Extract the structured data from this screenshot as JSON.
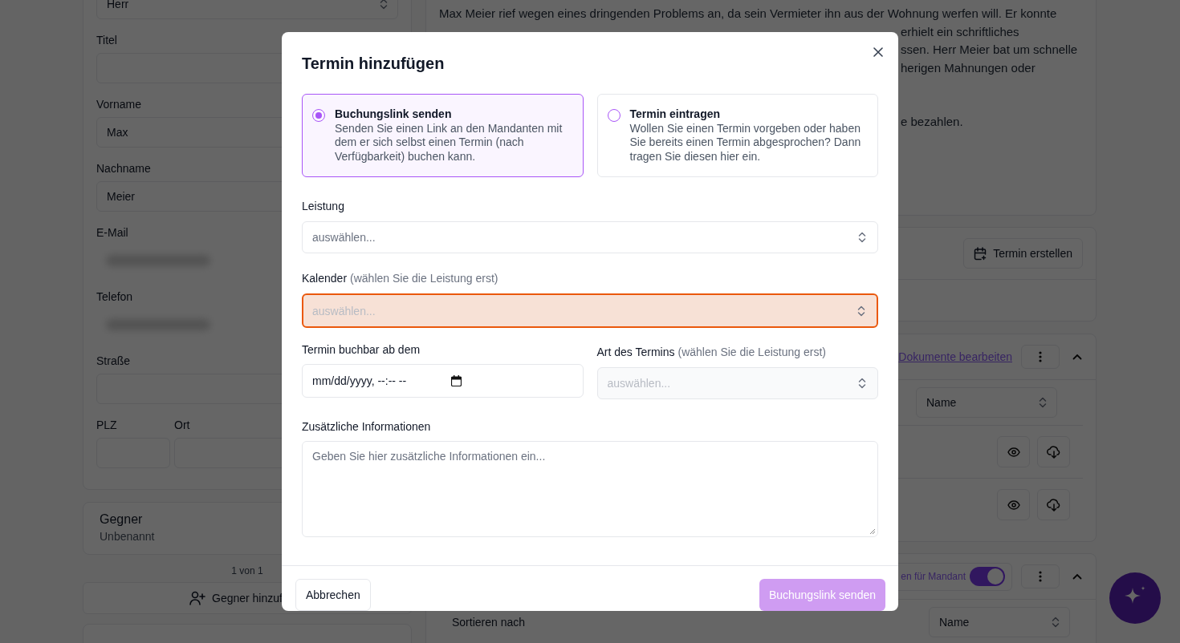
{
  "person_form": {
    "fields": [
      {
        "kind": "select",
        "value": "Herr"
      },
      {
        "kind": "text",
        "label": "Titel"
      },
      {
        "kind": "text",
        "label": "Vorname",
        "value": "Max"
      },
      {
        "kind": "text",
        "label": "Nachname",
        "value": "Meier"
      },
      {
        "kind": "redacted",
        "label": "E-Mail"
      },
      {
        "kind": "redacted",
        "label": "Telefon"
      },
      {
        "kind": "text",
        "label": "Straße"
      },
      {
        "kind": "pair",
        "parts": [
          {
            "label": "PLZ"
          },
          {
            "label": "Ort"
          }
        ]
      }
    ]
  },
  "opponent": {
    "title": "Gegner",
    "subtitle": "Unbenannt",
    "pager": "1 von 1",
    "add_button": "Gegner hinzuf"
  },
  "notes": {
    "lines": [
      {
        "kind": "full",
        "text": "Max Meier rief wegen eines dringenden Problems an, da sein Vermieter ihn aus der Wohnung werfen will. Er konnte"
      },
      {
        "kind": "tail",
        "text": "erhielt ein schriftliches"
      },
      {
        "kind": "tail",
        "text": "ssen. Herr Meier bat um schnelle"
      },
      {
        "kind": "tail",
        "text": "herigen Mahnungen oder"
      },
      {
        "kind": "tail_gap",
        "text": "e bezahlen."
      }
    ]
  },
  "appointments": {
    "create_button": "Termin erstellen"
  },
  "documents": {
    "edit_link": "Dokumente bearbeiten",
    "sort_value": "Name",
    "rows": [
      {
        "kind": "file"
      },
      {
        "kind": "file"
      }
    ]
  },
  "shared": {
    "toggle_label": "en für Mandant",
    "on": true,
    "sort_label": "Sortieren nach",
    "sort_value": "Name"
  },
  "modal": {
    "title": "Termin hinzufügen",
    "options": [
      {
        "title": "Buchungslink senden",
        "description": "Senden Sie einen Link an den Mandanten mit dem er sich selbst einen Termin (nach Verfügbarkeit) buchen kann.",
        "selected": true
      },
      {
        "title": "Termin eintragen",
        "description": "Wollen Sie einen Termin vorgeben oder haben Sie bereits einen Termin abgesprochen? Dann tragen Sie diesen hier ein.",
        "selected": false
      }
    ],
    "service": {
      "label": "Leistung",
      "placeholder": "auswählen...",
      "disabled": false,
      "error": false
    },
    "calendar": {
      "label": "Kalender",
      "hint": "(wählen Sie die Leistung erst)",
      "placeholder": "auswählen...",
      "disabled": true,
      "error": true
    },
    "bookable_from": {
      "label": "Termin buchbar ab dem",
      "value": "mm/dd/yyyy, --:-- --"
    },
    "type": {
      "label": "Art des Termins",
      "hint": "(wählen Sie die Leistung erst)",
      "placeholder": "auswählen...",
      "disabled": true,
      "error": false
    },
    "notes": {
      "label": "Zusätzliche Informationen",
      "placeholder": "Geben Sie hier zusätzliche Informationen ein..."
    },
    "cancel": "Abbrechen",
    "submit": "Buchungslink senden"
  }
}
